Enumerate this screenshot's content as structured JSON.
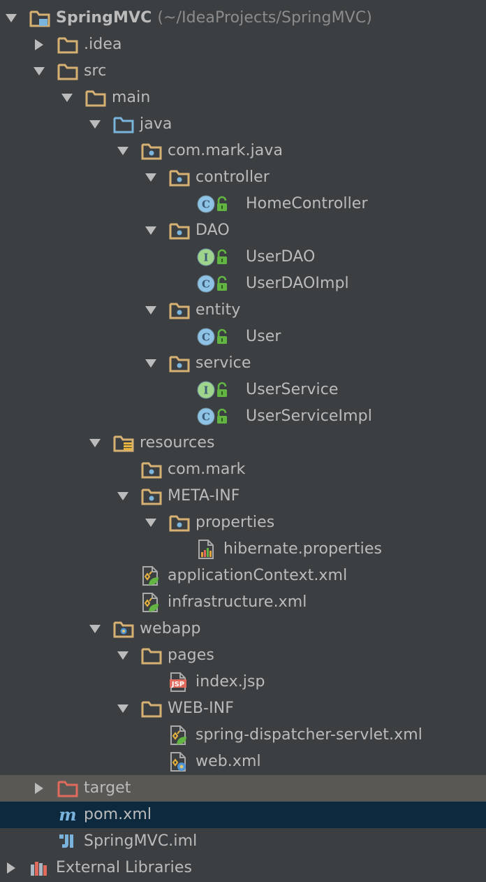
{
  "colors": {
    "background": "#3c3f41",
    "text": "#bbbbbb",
    "hint_text": "#8c8c8c",
    "folder_tan": "#d7b074",
    "source_folder_blue": "#7ab3dc",
    "excluded_folder_red": "#e06a5b",
    "selection_active": "#0d293e",
    "selection_inactive": "#5a5855"
  },
  "project": {
    "name": "SpringMVC",
    "path": "(~/IdeaProjects/SpringMVC)"
  },
  "tree": [
    {
      "label": "SpringMVC",
      "hint": "(~/IdeaProjects/SpringMVC)",
      "icon": "module-folder-icon",
      "arrow": "expanded"
    },
    {
      "label": ".idea",
      "icon": "folder-icon",
      "arrow": "collapsed"
    },
    {
      "label": "src",
      "icon": "folder-icon",
      "arrow": "expanded"
    },
    {
      "label": "main",
      "icon": "folder-icon",
      "arrow": "expanded"
    },
    {
      "label": "java",
      "icon": "source-folder-icon",
      "arrow": "expanded"
    },
    {
      "label": "com.mark.java",
      "icon": "package-icon",
      "arrow": "expanded"
    },
    {
      "label": "controller",
      "icon": "package-icon",
      "arrow": "expanded"
    },
    {
      "label": "HomeController",
      "icon": "class-icon",
      "arrow": "none"
    },
    {
      "label": "DAO",
      "icon": "package-icon",
      "arrow": "expanded"
    },
    {
      "label": "UserDAO",
      "icon": "interface-icon",
      "arrow": "none"
    },
    {
      "label": "UserDAOImpl",
      "icon": "class-icon",
      "arrow": "none"
    },
    {
      "label": "entity",
      "icon": "package-icon",
      "arrow": "expanded"
    },
    {
      "label": "User",
      "icon": "class-icon",
      "arrow": "none"
    },
    {
      "label": "service",
      "icon": "package-icon",
      "arrow": "expanded"
    },
    {
      "label": "UserService",
      "icon": "interface-icon",
      "arrow": "none"
    },
    {
      "label": "UserServiceImpl",
      "icon": "class-icon",
      "arrow": "none"
    },
    {
      "label": "resources",
      "icon": "resources-folder-icon",
      "arrow": "expanded"
    },
    {
      "label": "com.mark",
      "icon": "package-icon",
      "arrow": "none"
    },
    {
      "label": "META-INF",
      "icon": "package-icon",
      "arrow": "expanded"
    },
    {
      "label": "properties",
      "icon": "package-icon",
      "arrow": "expanded"
    },
    {
      "label": "hibernate.properties",
      "icon": "properties-file-icon",
      "arrow": "none"
    },
    {
      "label": "applicationContext.xml",
      "icon": "spring-xml-icon",
      "arrow": "none"
    },
    {
      "label": "infrastructure.xml",
      "icon": "spring-xml-icon",
      "arrow": "none"
    },
    {
      "label": "webapp",
      "icon": "web-folder-icon",
      "arrow": "expanded"
    },
    {
      "label": "pages",
      "icon": "folder-icon",
      "arrow": "expanded"
    },
    {
      "label": "index.jsp",
      "icon": "jsp-file-icon",
      "arrow": "none"
    },
    {
      "label": "WEB-INF",
      "icon": "folder-icon",
      "arrow": "expanded"
    },
    {
      "label": "spring-dispatcher-servlet.xml",
      "icon": "spring-xml-icon",
      "arrow": "none"
    },
    {
      "label": "web.xml",
      "icon": "web-xml-icon",
      "arrow": "none"
    },
    {
      "label": "target",
      "icon": "excluded-folder-icon",
      "arrow": "collapsed",
      "selection": "inactive"
    },
    {
      "label": "pom.xml",
      "icon": "maven-icon",
      "arrow": "none",
      "selection": "active"
    },
    {
      "label": "SpringMVC.iml",
      "icon": "iml-file-icon",
      "arrow": "none"
    },
    {
      "label": "External Libraries",
      "icon": "libraries-icon",
      "arrow": "collapsed"
    }
  ]
}
